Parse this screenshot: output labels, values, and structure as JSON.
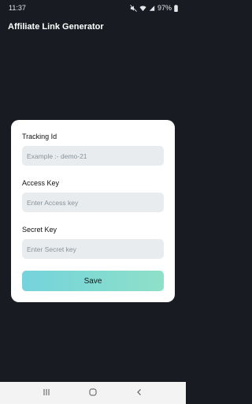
{
  "status_bar": {
    "time": "11:37",
    "battery": "97%",
    "icons": [
      "mute-icon",
      "wifi-icon",
      "signal-icon",
      "battery-icon"
    ]
  },
  "app": {
    "title": "Affiliate Link Generator"
  },
  "form": {
    "tracking_id": {
      "label": "Tracking Id",
      "placeholder": "Example :- demo-21",
      "value": ""
    },
    "access_key": {
      "label": "Access Key",
      "placeholder": "Enter Access key",
      "value": ""
    },
    "secret_key": {
      "label": "Secret Key",
      "placeholder": "Enter Secret key",
      "value": ""
    },
    "save_label": "Save"
  },
  "nav_bar": {
    "icons": [
      "recents-icon",
      "home-icon",
      "back-icon"
    ]
  },
  "colors": {
    "background": "#181c22",
    "card": "#ffffff",
    "input_bg": "#e8ecee",
    "button_gradient_start": "#74d3dc",
    "button_gradient_end": "#8ee0c7"
  }
}
